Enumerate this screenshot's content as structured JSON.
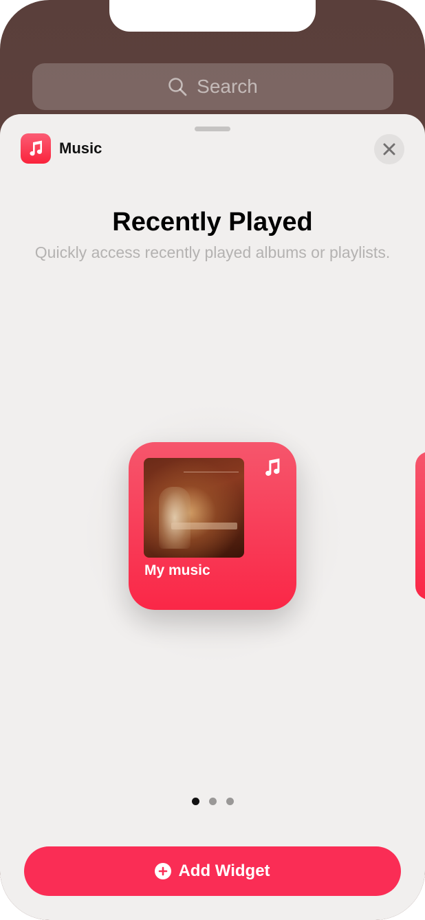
{
  "search": {
    "placeholder": "Search"
  },
  "sheet": {
    "app_name": "Music",
    "title": "Recently Played",
    "subtitle": "Quickly access recently played albums or playlists."
  },
  "widget": {
    "label": "My music",
    "icon": "music-note-icon",
    "album_art": "album-cover"
  },
  "pagination": {
    "total": 3,
    "current": 1
  },
  "actions": {
    "add_widget_label": "Add Widget"
  },
  "colors": {
    "accent": "#fa2d55",
    "widget_top": "#f6566c",
    "widget_bottom": "#fa2747",
    "sheet_bg": "#f1efee"
  }
}
